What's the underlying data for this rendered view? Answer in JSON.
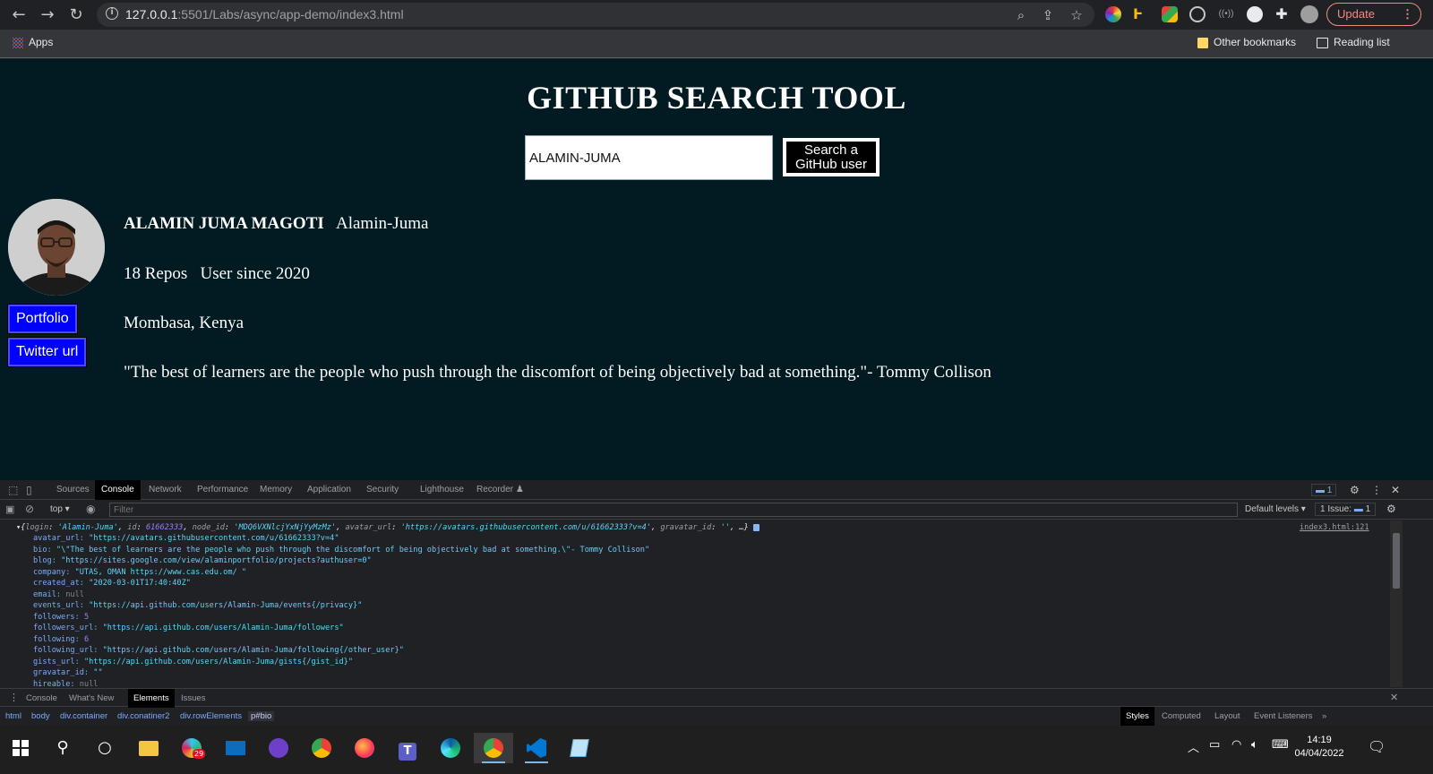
{
  "browser": {
    "url_host": "127.0.0.1",
    "url_path": ":5501/Labs/async/app-demo/index3.html",
    "update_label": "Update",
    "bookmarks": {
      "apps": "Apps",
      "other": "Other bookmarks",
      "reading": "Reading list"
    }
  },
  "page": {
    "title": "GITHUB SEARCH TOOL",
    "search_value": "ALAMIN-JUMA",
    "search_button_line1": "Search a",
    "search_button_line2": "GitHub user",
    "portfolio_label": "Portfolio",
    "twitter_label": "Twitter url",
    "name": "ALAMIN JUMA MAGOTI",
    "login": "Alamin-Juma",
    "repos": "18 Repos",
    "since": "User since 2020",
    "location": "Mombasa, Kenya",
    "bio": "\"The best of learners are the people who push through the discomfort of being objectively bad at something.\"- Tommy Collison"
  },
  "devtools": {
    "tabs": [
      "Sources",
      "Console",
      "Network",
      "Performance",
      "Memory",
      "Application",
      "Security",
      "Lighthouse",
      "Recorder"
    ],
    "active_tab": "Console",
    "issue_badge": "1",
    "context": "top",
    "filter_placeholder": "Filter",
    "levels": "Default levels",
    "issues_label": "1 Issue:",
    "issues_count": "1",
    "source_link": "index3.html:121",
    "summary": {
      "login_key": "login",
      "login_val": "'Alamin-Juma'",
      "id_key": "id",
      "id_val": "61662333",
      "node_key": "node_id",
      "node_val": "'MDQ6VXNlcjYxNjYyMzMz'",
      "avatar_key": "avatar_url",
      "avatar_val": "'https://avatars.githubusercontent.com/u/61662333?v=4'",
      "grav_key": "gravatar_id",
      "grav_val": "''",
      "tail": ", …}"
    },
    "lines": [
      {
        "k": "avatar_url",
        "v": "\"https://avatars.githubusercontent.com/u/61662333?v=4\"",
        "t": "s"
      },
      {
        "k": "bio",
        "v": "\"\\\"The best of learners are the people who push through the discomfort of being objectively bad at something.\\\"- Tommy Collison\"",
        "t": "s"
      },
      {
        "k": "blog",
        "v": "\"https://sites.google.com/view/alaminportfolio/projects?authuser=0\"",
        "t": "s"
      },
      {
        "k": "company",
        "v": "\"UTAS, OMAN   https://www.cas.edu.om/   \"",
        "t": "s"
      },
      {
        "k": "created_at",
        "v": "\"2020-03-01T17:40:40Z\"",
        "t": "s"
      },
      {
        "k": "email",
        "v": "null",
        "t": "nl"
      },
      {
        "k": "events_url",
        "v": "\"https://api.github.com/users/Alamin-Juma/events{/privacy}\"",
        "t": "s"
      },
      {
        "k": "followers",
        "v": "5",
        "t": "n"
      },
      {
        "k": "followers_url",
        "v": "\"https://api.github.com/users/Alamin-Juma/followers\"",
        "t": "s"
      },
      {
        "k": "following",
        "v": "6",
        "t": "n"
      },
      {
        "k": "following_url",
        "v": "\"https://api.github.com/users/Alamin-Juma/following{/other_user}\"",
        "t": "s"
      },
      {
        "k": "gists_url",
        "v": "\"https://api.github.com/users/Alamin-Juma/gists{/gist_id}\"",
        "t": "s"
      },
      {
        "k": "gravatar_id",
        "v": "\"\"",
        "t": "s"
      },
      {
        "k": "hireable",
        "v": "null",
        "t": "nl"
      }
    ],
    "drawer_tabs": [
      "Console",
      "What's New",
      "Elements",
      "Issues"
    ],
    "drawer_active": "Elements",
    "breadcrumbs": [
      "html",
      "body",
      "div.container",
      "div.conatiner2",
      "div.rowElements",
      "p#bio"
    ],
    "side_tabs": [
      "Styles",
      "Computed",
      "Layout",
      "Event Listeners",
      "»"
    ]
  },
  "taskbar": {
    "time": "14:19",
    "date": "04/04/2022",
    "badge": "29"
  },
  "colors": {
    "page_bg": "#021a21",
    "link_btn": "#0000ff",
    "update": "#f28b82"
  }
}
